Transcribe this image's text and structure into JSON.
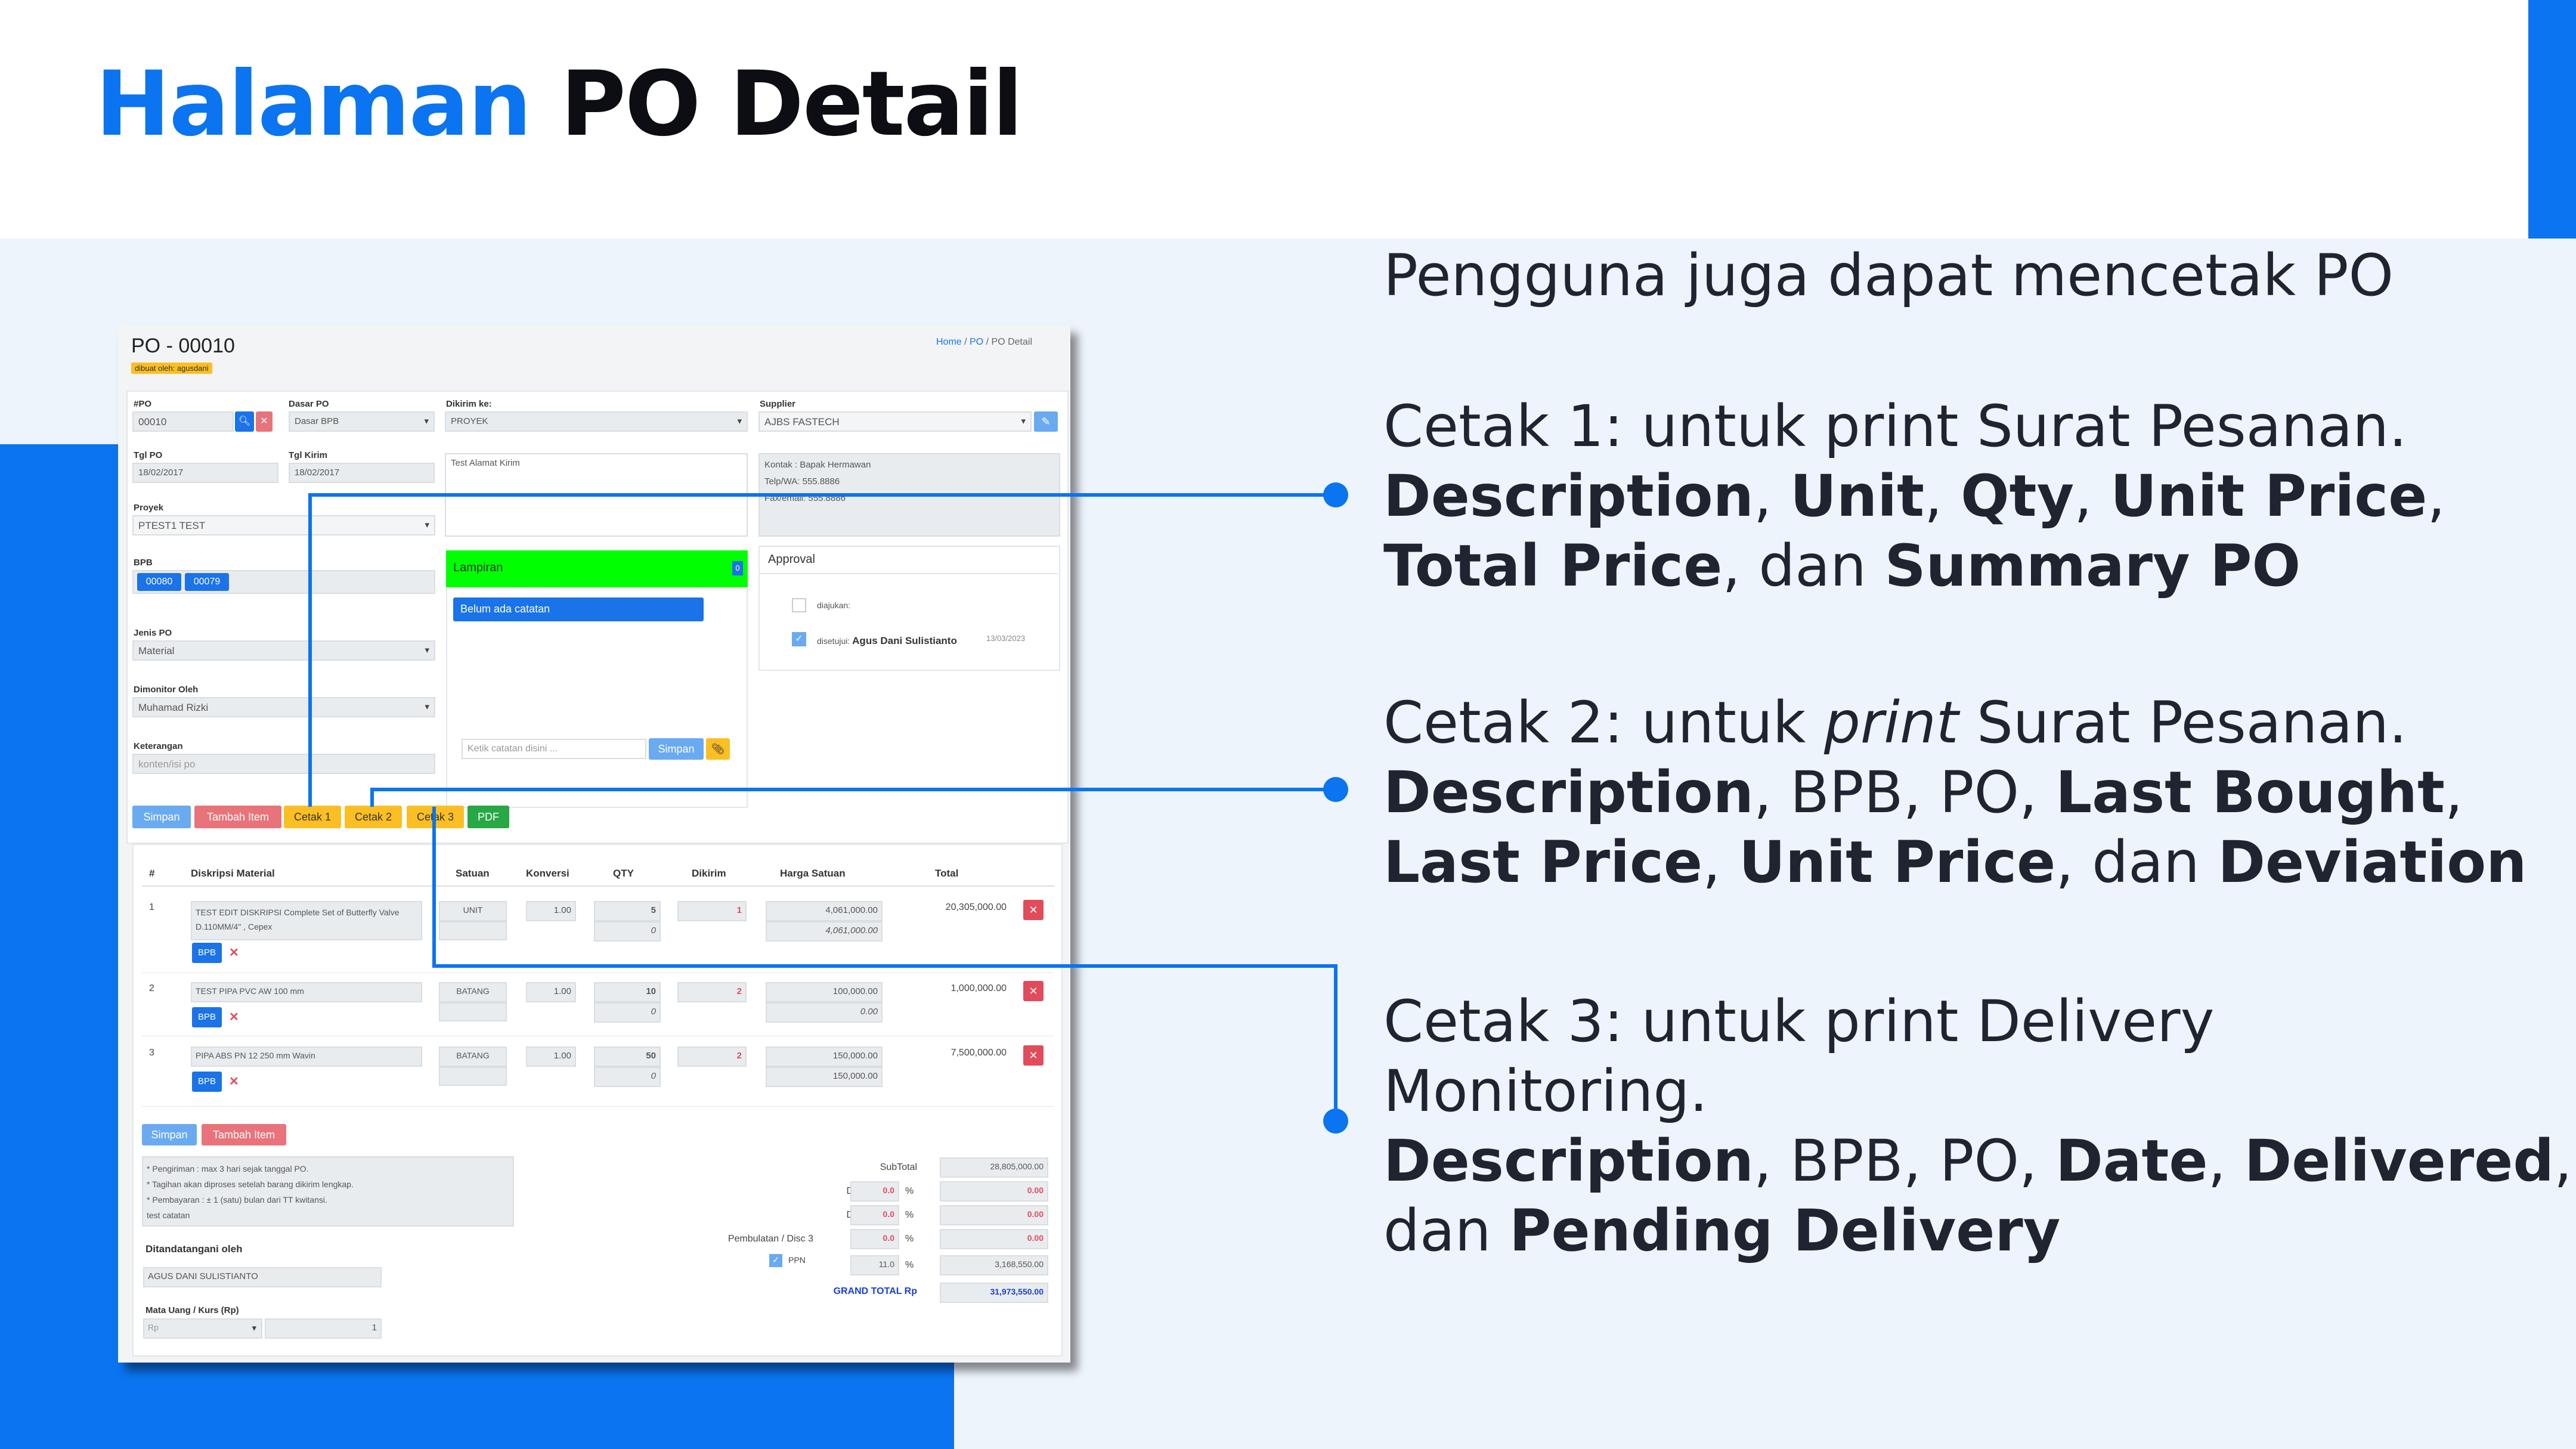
{
  "slide": {
    "title_blue": "Halaman",
    "title_black": "PO Detail"
  },
  "description": {
    "intro": "Pengguna juga dapat mencetak PO",
    "cetak1": {
      "line1": "Cetak 1: untuk print Surat Pesanan.",
      "b1": "Description",
      "s1": ", ",
      "b2": "Unit",
      "s2": ", ",
      "b3": "Qty",
      "s3": ", ",
      "b4": "Unit Price",
      "s4": ",",
      "b5": "Total Price",
      "s5": ", dan ",
      "b6": "Summary PO"
    },
    "cetak2": {
      "pre": "Cetak 2: untuk ",
      "ital": "print",
      "post": " Surat Pesanan.",
      "b1": "Description",
      "s1": ", BPB, PO, ",
      "b2": "Last Bought",
      "s2": ",",
      "b3": "Last Price",
      "s3": ", ",
      "b4": "Unit Price",
      "s4": ", dan ",
      "b5": "Deviation"
    },
    "cetak3": {
      "line1": "Cetak 3: untuk print Delivery",
      "line2": "Monitoring.",
      "b1": "Description",
      "s1": ", BPB, PO, ",
      "b2": "Date",
      "s2": ", ",
      "b3": "Delivered",
      "s3": ",",
      "s4": "dan ",
      "b4": "Pending Delivery"
    }
  },
  "app": {
    "page_title": "PO - 00010",
    "created_badge": "dibuat oleh: agusdani",
    "breadcrumb": {
      "home": "Home",
      "sep1": "/",
      "po": "PO",
      "sep2": "/",
      "current": "PO Detail"
    },
    "form": {
      "po_label": "#PO",
      "po_value": "00010",
      "dasar_label": "Dasar PO",
      "dasar_value": "Dasar BPB",
      "tgl_po_label": "Tgl PO",
      "tgl_po_value": "18/02/2017",
      "tgl_kirim_label": "Tgl Kirim",
      "tgl_kirim_value": "18/02/2017",
      "proyek_label": "Proyek",
      "proyek_value": "PTEST1 TEST",
      "bpb_label": "BPB",
      "bpb_tags": [
        "00080",
        "00079"
      ],
      "jenis_label": "Jenis PO",
      "jenis_value": "Material",
      "dimonitor_label": "Dimonitor Oleh",
      "dimonitor_value": "Muhamad Rizki",
      "keterangan_label": "Keterangan",
      "keterangan_placeholder": "konten/isi po",
      "dikirim_label": "Dikirim ke:",
      "dikirim_value": "PROYEK",
      "alamat_value": "Test Alamat Kirim",
      "supplier_label": "Supplier",
      "supplier_value": "AJBS FASTECH",
      "kontak_line1": "Kontak : Bapak Hermawan",
      "kontak_line2": "Telp/WA: 555.8886",
      "kontak_line3": "Fax/email: 555.8886"
    },
    "lampiran": {
      "title": "Lampiran",
      "count": "0",
      "note": "Belum ada catatan",
      "input_placeholder": "Ketik catatan disini ...",
      "save": "Simpan"
    },
    "approval": {
      "title": "Approval",
      "row1_label": "diajukan:",
      "row2_label": "disetujui:",
      "row2_name": "Agus Dani Sulistianto",
      "row2_date": "13/03/2023"
    },
    "buttons": {
      "simpan": "Simpan",
      "tambah": "Tambah Item",
      "cetak1": "Cetak 1",
      "cetak2": "Cetak 2",
      "cetak3": "Cetak 3",
      "pdf": "PDF"
    },
    "table": {
      "headers": [
        "#",
        "Diskripsi Material",
        "Satuan",
        "Konversi",
        "QTY",
        "Dikirim",
        "Harga Satuan",
        "Total"
      ],
      "bpb_button": "BPB",
      "rows": [
        {
          "no": "1",
          "desc": "TEST EDIT DISKRIPSI  Complete Set of Butterfly Valve D.110MM/4\" , Cepex",
          "satuan": "UNIT",
          "konversi": "1.00",
          "qty": "5",
          "qty2": "0",
          "dikirim": "1",
          "harga": "4,061,000.00",
          "harga2": "4,061,000.00",
          "total": "20,305,000.00"
        },
        {
          "no": "2",
          "desc": "TEST PIPA PVC AW 100 mm",
          "satuan": "BATANG",
          "konversi": "1.00",
          "qty": "10",
          "qty2": "0",
          "dikirim": "2",
          "harga": "100,000.00",
          "harga2": "0.00",
          "total": "1,000,000.00"
        },
        {
          "no": "3",
          "desc": "PIPA ABS PN 12 250 mm  Wavin",
          "satuan": "BATANG",
          "konversi": "1.00",
          "qty": "50",
          "qty2": "0",
          "dikirim": "2",
          "harga": "150,000.00",
          "harga2": "150,000.00",
          "total": "7,500,000.00"
        }
      ]
    },
    "bottom": {
      "simpan": "Simpan",
      "tambah": "Tambah Item",
      "notes": [
        "* Pengiriman : max 3 hari sejak tanggal PO.",
        "* Tagihan akan diproses setelah barang dikirim lengkap.",
        "* Pembayaran : ± 1 (satu) bulan dari TT kwitansi.",
        "test catatan"
      ],
      "ditandatangani_label": "Ditandatangani oleh",
      "ditandatangani_value": "AGUS DANI SULISTIANTO",
      "mata_uang_label": "Mata Uang / Kurs (Rp)",
      "mata_uang_value": "Rp",
      "kurs_value": "1"
    },
    "summary": {
      "subtotal_label": "SubTotal",
      "subtotal": "28,805,000.00",
      "disc1_label": "Disc 1",
      "disc1_pct": "0.0",
      "disc1": "0.00",
      "disc2_label": "Disc 2",
      "disc2_pct": "0.0",
      "disc2": "0.00",
      "disc3_label": "Pembulatan / Disc 3",
      "disc3_pct": "0.0",
      "disc3": "0.00",
      "ppn_label": "PPN",
      "ppn_pct": "11.0",
      "ppn": "3,168,550.00",
      "pct": "%",
      "grand_label": "GRAND TOTAL Rp",
      "grand": "31,973,550.00"
    }
  }
}
